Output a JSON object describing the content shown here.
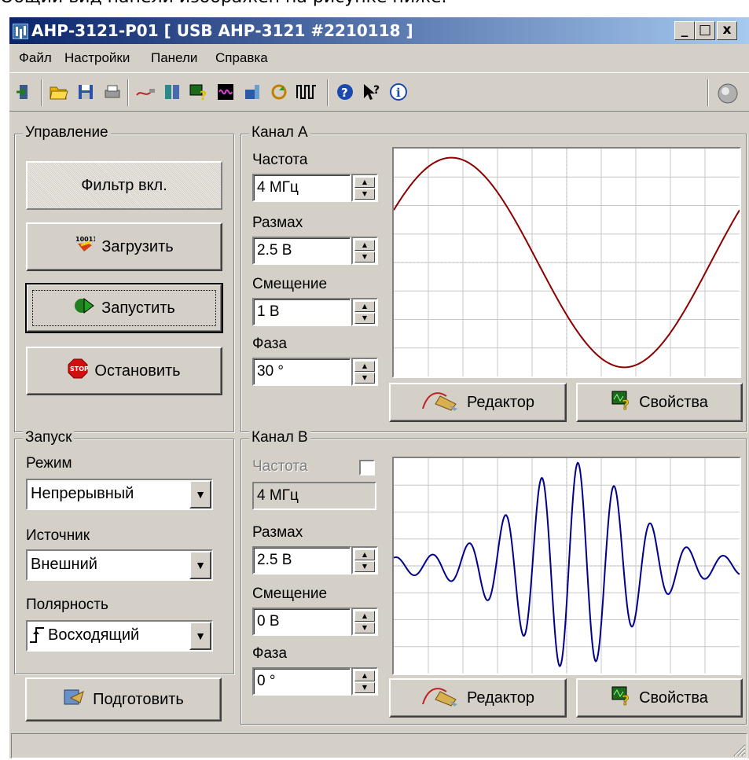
{
  "caption": "Общий вид панели изображен на рисунке ниже.",
  "window": {
    "title": "АНР-3121-Р01 [ USB АНР-3121 #2210118 ]",
    "minimize": "_",
    "maximize": "□",
    "close": "x"
  },
  "menu": [
    "Файл",
    "Настройки",
    "Панели",
    "Справка"
  ],
  "toolbar_icons": [
    "exit-icon",
    "open-folder-icon",
    "save-icon",
    "print-icon",
    "cable-icon",
    "channels-icon",
    "help-module-icon",
    "waveform-scope-icon",
    "device-icon",
    "refresh-icon",
    "pulse-icon",
    "help-icon",
    "context-help-icon",
    "info-icon",
    "status-led-icon"
  ],
  "control": {
    "title": "Управление",
    "filter_button": "Фильтр вкл.",
    "load_button": "Загрузить",
    "start_button": "Запустить",
    "stop_button": "Остановить"
  },
  "channel_a": {
    "title": "Канал А",
    "frequency_label": "Частота",
    "frequency_value": "4 МГц",
    "amplitude_label": "Размах",
    "amplitude_value": "2.5 В",
    "offset_label": "Смещение",
    "offset_value": "1 В",
    "phase_label": "Фаза",
    "phase_value": "30 °",
    "editor_button": "Редактор",
    "properties_button": "Свойства",
    "waveform_color": "#8b0000"
  },
  "trigger": {
    "title": "Запуск",
    "mode_label": "Режим",
    "mode_value": "Непрерывный",
    "source_label": "Источник",
    "source_value": "Внешний",
    "polarity_label": "Полярность",
    "polarity_value": "Восходящий",
    "prepare_button": "Подготовить"
  },
  "channel_b": {
    "title": "Канал В",
    "frequency_label": "Частота",
    "frequency_value": "4 МГц",
    "amplitude_label": "Размах",
    "amplitude_value": "2.5 В",
    "offset_label": "Смещение",
    "offset_value": "0 В",
    "phase_label": "Фаза",
    "phase_value": "0 °",
    "editor_button": "Редактор",
    "properties_button": "Свойства",
    "waveform_color": "#00008b"
  }
}
